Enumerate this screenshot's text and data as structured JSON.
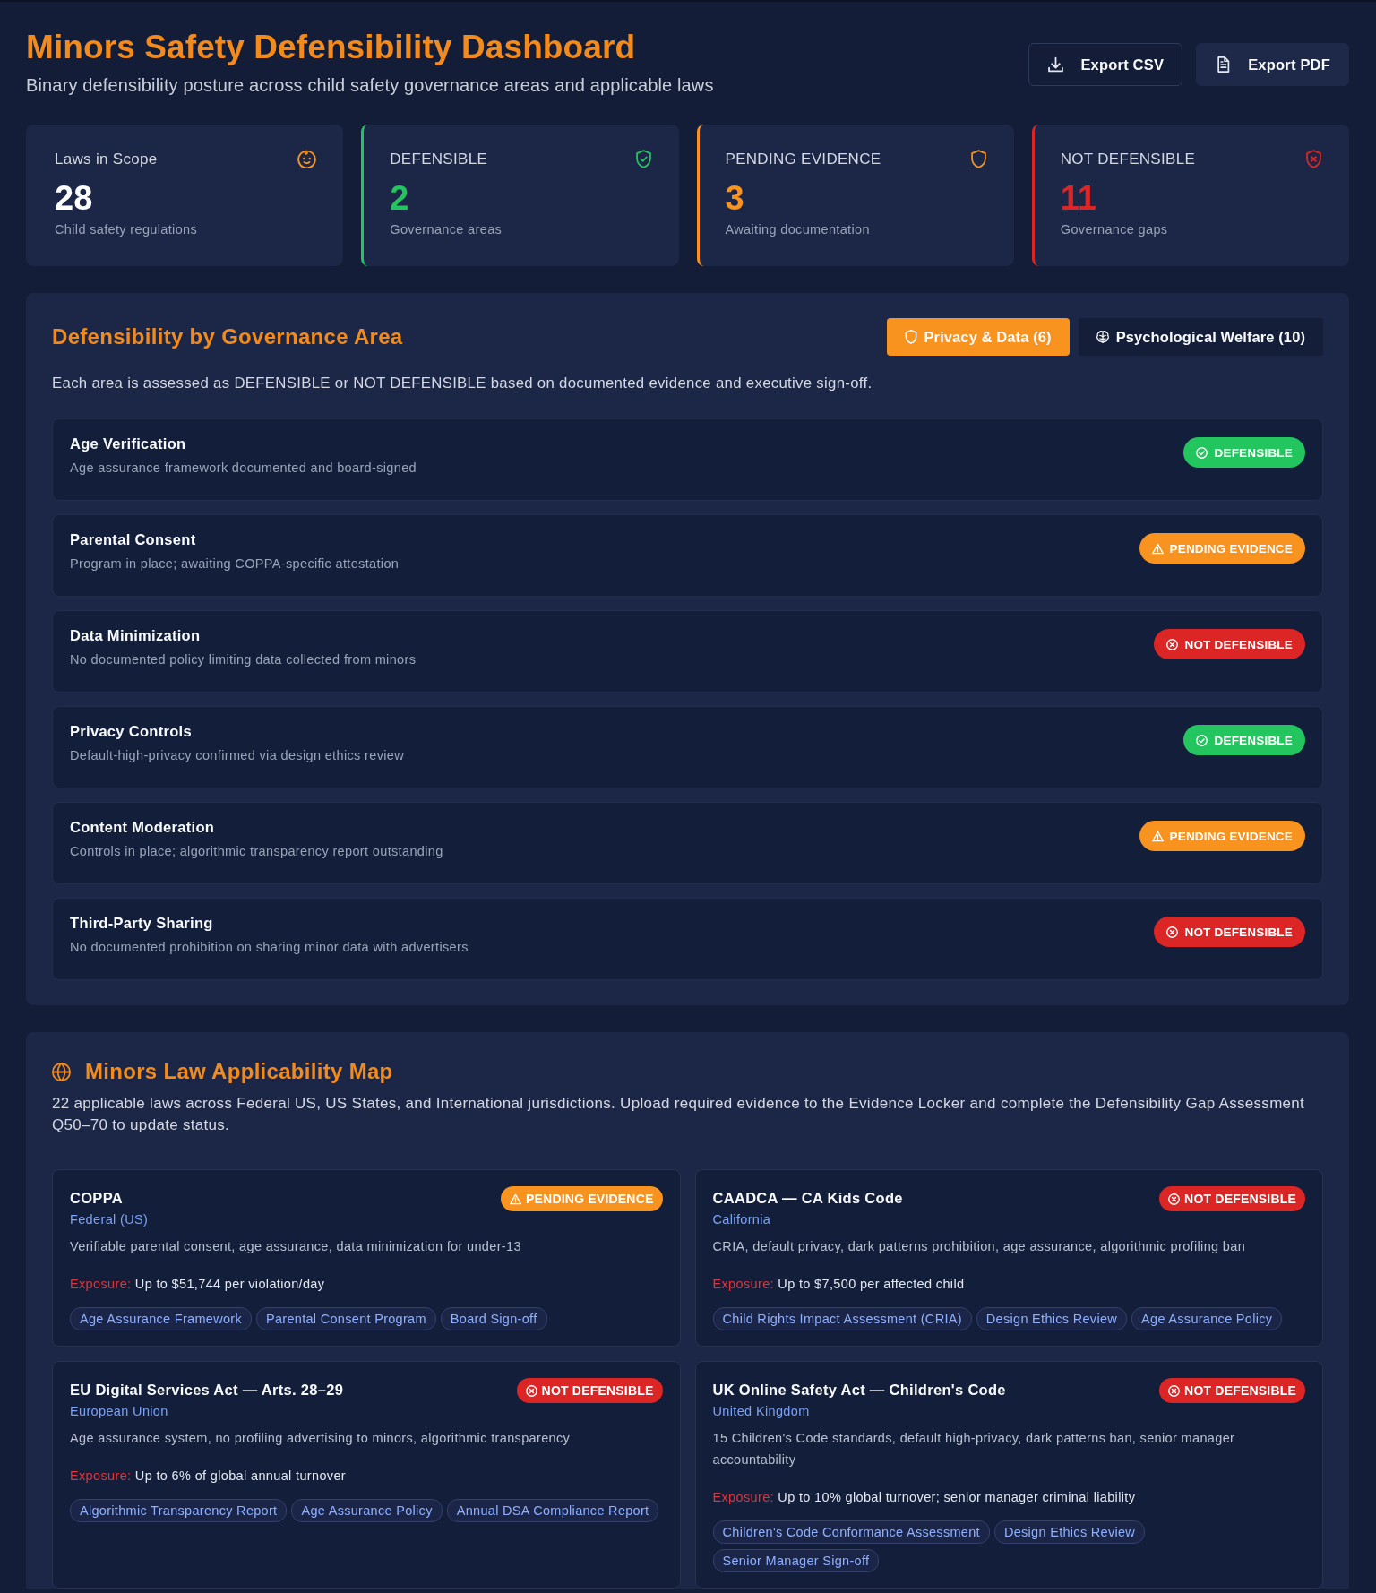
{
  "header": {
    "title": "Minors Safety Defensibility Dashboard",
    "subtitle": "Binary defensibility posture across child safety governance areas and applicable laws"
  },
  "actions": [
    {
      "label": "Export CSV",
      "kind": "download"
    },
    {
      "label": "Export PDF",
      "kind": "document"
    }
  ],
  "stats": [
    {
      "label": "Laws in Scope",
      "value": "28",
      "caption": "Child safety regulations",
      "kind": "scope"
    },
    {
      "label": "DEFENSIBLE",
      "value": "2",
      "caption": "Governance areas",
      "kind": "defensible"
    },
    {
      "label": "PENDING EVIDENCE",
      "value": "3",
      "caption": "Awaiting documentation",
      "kind": "pending"
    },
    {
      "label": "NOT DEFENSIBLE",
      "value": "11",
      "caption": "Governance gaps",
      "kind": "not_defensible"
    }
  ],
  "governance": {
    "title": "Defensibility by Governance Area",
    "tabs": [
      {
        "label": "Privacy & Data (6)",
        "selected": true,
        "kind": "shield"
      },
      {
        "label": "Psychological Welfare (10)",
        "selected": false,
        "kind": "brain"
      }
    ],
    "description": "Each area is assessed as DEFENSIBLE or NOT DEFENSIBLE based on documented evidence and executive sign-off.",
    "areas": [
      {
        "name": "Age Verification",
        "detail": "Age assurance framework documented and board-signed",
        "kind": "defensible",
        "badge": "DEFENSIBLE"
      },
      {
        "name": "Parental Consent",
        "detail": "Program in place; awaiting COPPA-specific attestation",
        "kind": "pending",
        "badge": "PENDING EVIDENCE"
      },
      {
        "name": "Data Minimization",
        "detail": "No documented policy limiting data collected from minors",
        "kind": "not_defensible",
        "badge": "NOT DEFENSIBLE"
      },
      {
        "name": "Privacy Controls",
        "detail": "Default-high-privacy confirmed via design ethics review",
        "kind": "defensible",
        "badge": "DEFENSIBLE"
      },
      {
        "name": "Content Moderation",
        "detail": "Controls in place; algorithmic transparency report outstanding",
        "kind": "pending",
        "badge": "PENDING EVIDENCE"
      },
      {
        "name": "Third-Party Sharing",
        "detail": "No documented prohibition on sharing minor data with advertisers",
        "kind": "not_defensible",
        "badge": "NOT DEFENSIBLE"
      }
    ]
  },
  "law_map": {
    "title": "Minors Law Applicability Map",
    "description": "22 applicable laws across Federal US, US States, and International jurisdictions. Upload required evidence to the Evidence Locker and complete the Defensibility Gap Assessment Q50–70 to update status.",
    "laws": [
      {
        "name": "COPPA",
        "jurisdiction": "Federal (US)",
        "kind": "pending",
        "badge": "PENDING EVIDENCE",
        "summary": "Verifiable parental consent, age assurance, data minimization for under-13",
        "exposure_label": "Exposure:",
        "exposure": "Up to $51,744 per violation/day",
        "evidence": [
          "Age Assurance Framework",
          "Parental Consent Program",
          "Board Sign-off"
        ]
      },
      {
        "name": "CAADCA — CA Kids Code",
        "jurisdiction": "California",
        "kind": "not_defensible",
        "badge": "NOT DEFENSIBLE",
        "summary": "CRIA, default privacy, dark patterns prohibition, age assurance, algorithmic profiling ban",
        "exposure_label": "Exposure:",
        "exposure": "Up to $7,500 per affected child",
        "evidence": [
          "Child Rights Impact Assessment (CRIA)",
          "Design Ethics Review",
          "Age Assurance Policy"
        ]
      },
      {
        "name": "EU Digital Services Act — Arts. 28–29",
        "jurisdiction": "European Union",
        "kind": "not_defensible",
        "badge": "NOT DEFENSIBLE",
        "summary": "Age assurance system, no profiling advertising to minors, algorithmic transparency",
        "exposure_label": "Exposure:",
        "exposure": "Up to 6% of global annual turnover",
        "evidence": [
          "Algorithmic Transparency Report",
          "Age Assurance Policy",
          "Annual DSA Compliance Report"
        ]
      },
      {
        "name": "UK Online Safety Act — Children's Code",
        "jurisdiction": "United Kingdom",
        "kind": "not_defensible",
        "badge": "NOT DEFENSIBLE",
        "summary": "15 Children's Code standards, default high-privacy, dark patterns ban, senior manager accountability",
        "exposure_label": "Exposure:",
        "exposure": "Up to 10% global turnover; senior manager criminal liability",
        "evidence": [
          "Children's Code Conformance Assessment",
          "Design Ethics Review",
          "Senior Manager Sign-off"
        ]
      }
    ]
  }
}
